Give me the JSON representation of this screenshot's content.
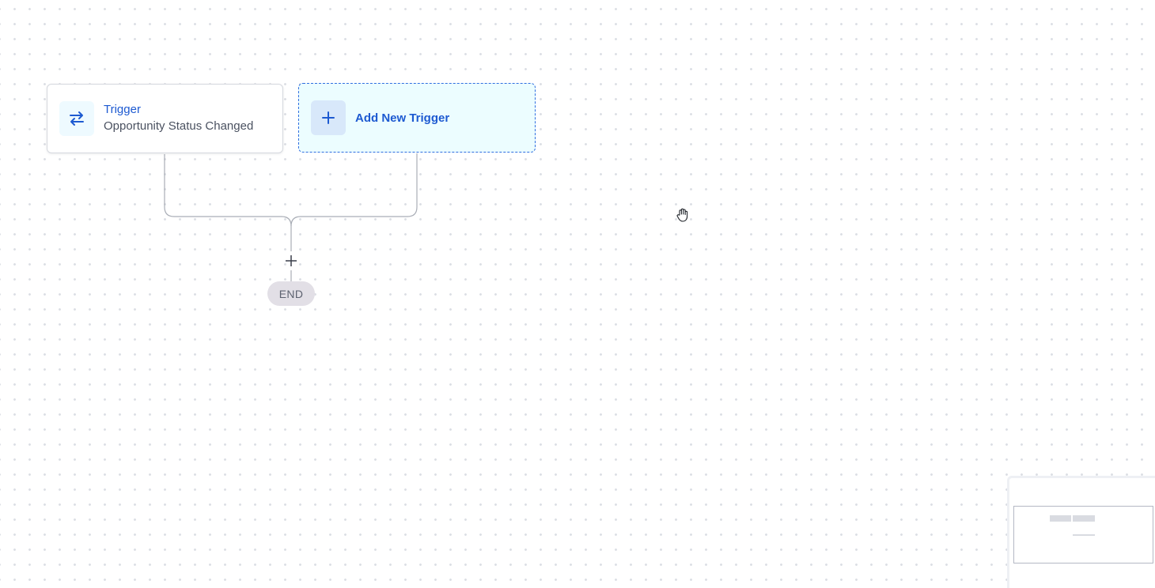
{
  "workflow": {
    "trigger_node": {
      "title": "Trigger",
      "subtitle": "Opportunity Status Changed",
      "icon": "swap-arrows-icon"
    },
    "add_trigger_node": {
      "label": "Add New Trigger",
      "icon": "plus-icon"
    },
    "add_step": {
      "icon": "plus-icon"
    },
    "end_node": {
      "label": "END"
    }
  },
  "canvas": {
    "cursor": "grab-hand-icon"
  },
  "minimap": {
    "visible": true
  },
  "colors": {
    "accent": "#1d5ad1",
    "add_node_bg": "#ecfdff",
    "end_pill_bg": "#e2dfe6",
    "connector": "#a9adb6",
    "dot_grid": "#dcdfe5"
  }
}
